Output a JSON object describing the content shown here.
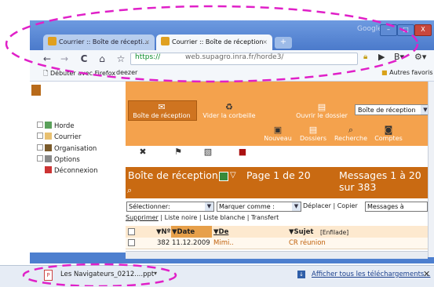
{
  "browser": {
    "tabs": [
      {
        "label": "Courrier :: Boîte de récepti...",
        "close": "×"
      },
      {
        "label": "Courrier :: Boîte de réception",
        "close": "×"
      }
    ],
    "new_tab": "+",
    "brand": "Google",
    "window_buttons": [
      "–",
      "□",
      "X"
    ],
    "nav": {
      "back": "←",
      "forward": "→",
      "reload": "C",
      "home": "⌂",
      "star": "☆"
    },
    "url_scheme": "https://",
    "url_rest": "web.supagro.inra.fr/horde3/",
    "go": "▶",
    "page_menu": "B▾",
    "wrench": "⚙▾",
    "bookmarks": [
      "Débuter avec Firefox",
      "deezer"
    ],
    "bookmarks_other": "Autres favoris"
  },
  "sidebar": {
    "items": [
      {
        "label": "Horde",
        "icon": "folder-icon"
      },
      {
        "label": "Courrier",
        "icon": "mail-icon"
      },
      {
        "label": "Organisation",
        "icon": "gear-icon"
      },
      {
        "label": "Options",
        "icon": "tools-icon"
      },
      {
        "label": "Déconnexion",
        "icon": "logout-icon"
      }
    ]
  },
  "mail_toolbar": {
    "row1": [
      "Boîte de réception",
      "Vider la corbeille",
      "Ouvrir le dossier"
    ],
    "folder_select": "Boîte de réception",
    "row2": [
      "Nouveau",
      "Dossiers",
      "Recherche",
      "Comptes"
    ],
    "row3": [
      "Options",
      "Problème",
      "Aide",
      "Déconnexion"
    ]
  },
  "mailbox": {
    "title": "Boîte de réception",
    "page": "Page 1 de 20",
    "messages": "Messages 1 à 20",
    "messages2": "sur 383",
    "select_label": "Sélectionner:",
    "mark_label": "Marquer comme :",
    "move": "Déplacer",
    "copy": "Copier",
    "target_select": "Messages à",
    "links": [
      "Supprimer",
      "Liste noire",
      "Liste blanche",
      "Transfert"
    ],
    "columns": {
      "num": "▼Nº",
      "date": "▼Date",
      "from": "▼De",
      "subject": "▼Sujet",
      "thread": "[Enfilade]"
    },
    "rows": [
      {
        "num": "382",
        "date": "11.12.2009",
        "from": "Mimi..",
        "subject": "CR réunion"
      }
    ]
  },
  "downloads": {
    "file": "Les Navigateurs_0212....ppt",
    "show_all": "Afficher tous les téléchargements...",
    "close": "✕"
  },
  "colors": {
    "chrome_blue": "#4b7acb",
    "horde_orange": "#f4a24d",
    "header_orange": "#c96a12",
    "annotation_magenta": "#e020c8"
  }
}
